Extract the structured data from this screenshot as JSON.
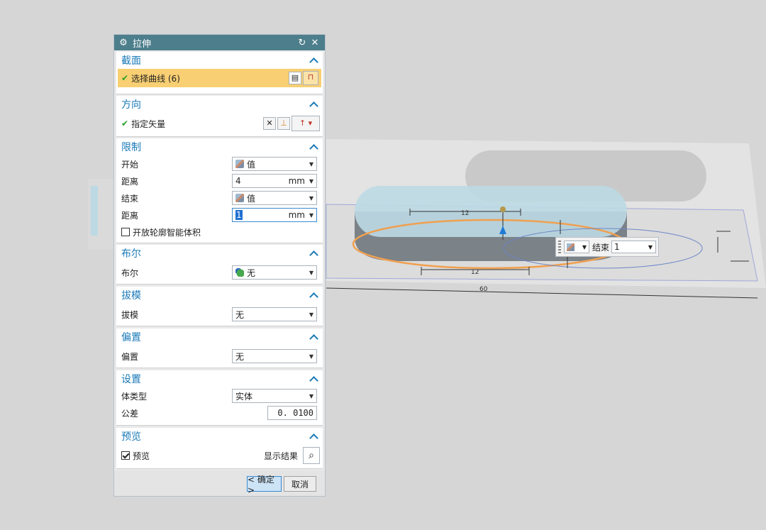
{
  "dialog": {
    "title": "拉伸",
    "section": {
      "title": "截面",
      "select_curve": "选择曲线 (6)"
    },
    "direction": {
      "title": "方向",
      "specify_vector": "指定矢量"
    },
    "limits": {
      "title": "限制",
      "start_label": "开始",
      "start_value": "值",
      "start_distance_label": "距离",
      "start_distance": "4",
      "start_unit": "mm",
      "end_label": "结束",
      "end_value": "值",
      "end_distance_label": "距离",
      "end_distance": "1",
      "end_unit": "mm",
      "open_profile": "开放轮廓智能体积"
    },
    "boolean": {
      "title": "布尔",
      "label": "布尔",
      "value": "无"
    },
    "draft": {
      "title": "拔模",
      "label": "拔模",
      "value": "无"
    },
    "offset": {
      "title": "偏置",
      "label": "偏置",
      "value": "无"
    },
    "settings": {
      "title": "设置",
      "body_type_label": "体类型",
      "body_type": "实体",
      "tolerance_label": "公差",
      "tolerance": "0. 0100"
    },
    "preview": {
      "title": "预览",
      "preview_label": "预览",
      "show_result": "显示结果"
    },
    "ok": "< 确定 >",
    "cancel": "取消"
  },
  "float_bar": {
    "label": "结束",
    "value": "1"
  },
  "dimensions": {
    "top_len": "12",
    "bottom_len": "12",
    "total": "60"
  },
  "colors": {
    "title_bar": "#4d7e8c",
    "section_title": "#1a7ab8",
    "selection": "#f8cf72",
    "sketch_curve": "#f0a050",
    "extrusion": "#bcd9e4"
  }
}
